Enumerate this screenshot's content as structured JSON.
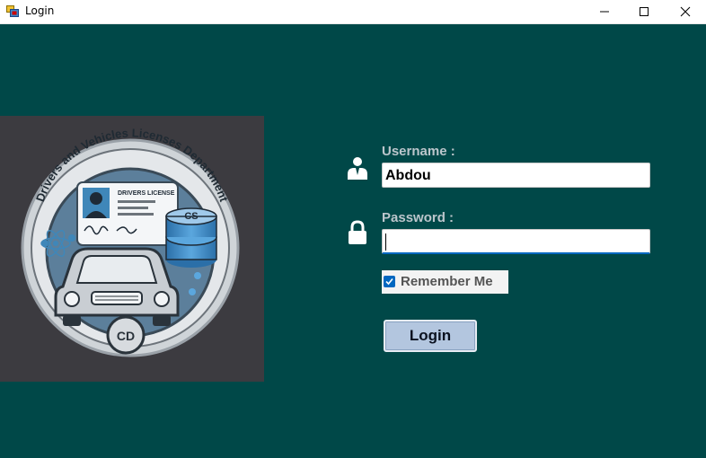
{
  "window": {
    "title": "Login",
    "controls": [
      "minimize",
      "maximize",
      "close"
    ]
  },
  "logo": {
    "arc_text": "Drivers and Vehicles Licenses Department",
    "card_text": "DRIVERS LICENSE",
    "db_label": "CS",
    "badge_text": "CD"
  },
  "form": {
    "username_label": "Username :",
    "username_value": "Abdou",
    "password_label": "Password :",
    "password_value": "",
    "remember_label": "Remember Me",
    "remember_checked": true,
    "login_label": "Login"
  },
  "colors": {
    "background": "#004848",
    "label": "#bcc6cc",
    "button": "#b3c6df",
    "accent": "#0067c0"
  },
  "icons": [
    "app-icon",
    "minimize-icon",
    "maximize-icon",
    "close-icon",
    "user-icon",
    "lock-icon",
    "checkmark-icon"
  ]
}
